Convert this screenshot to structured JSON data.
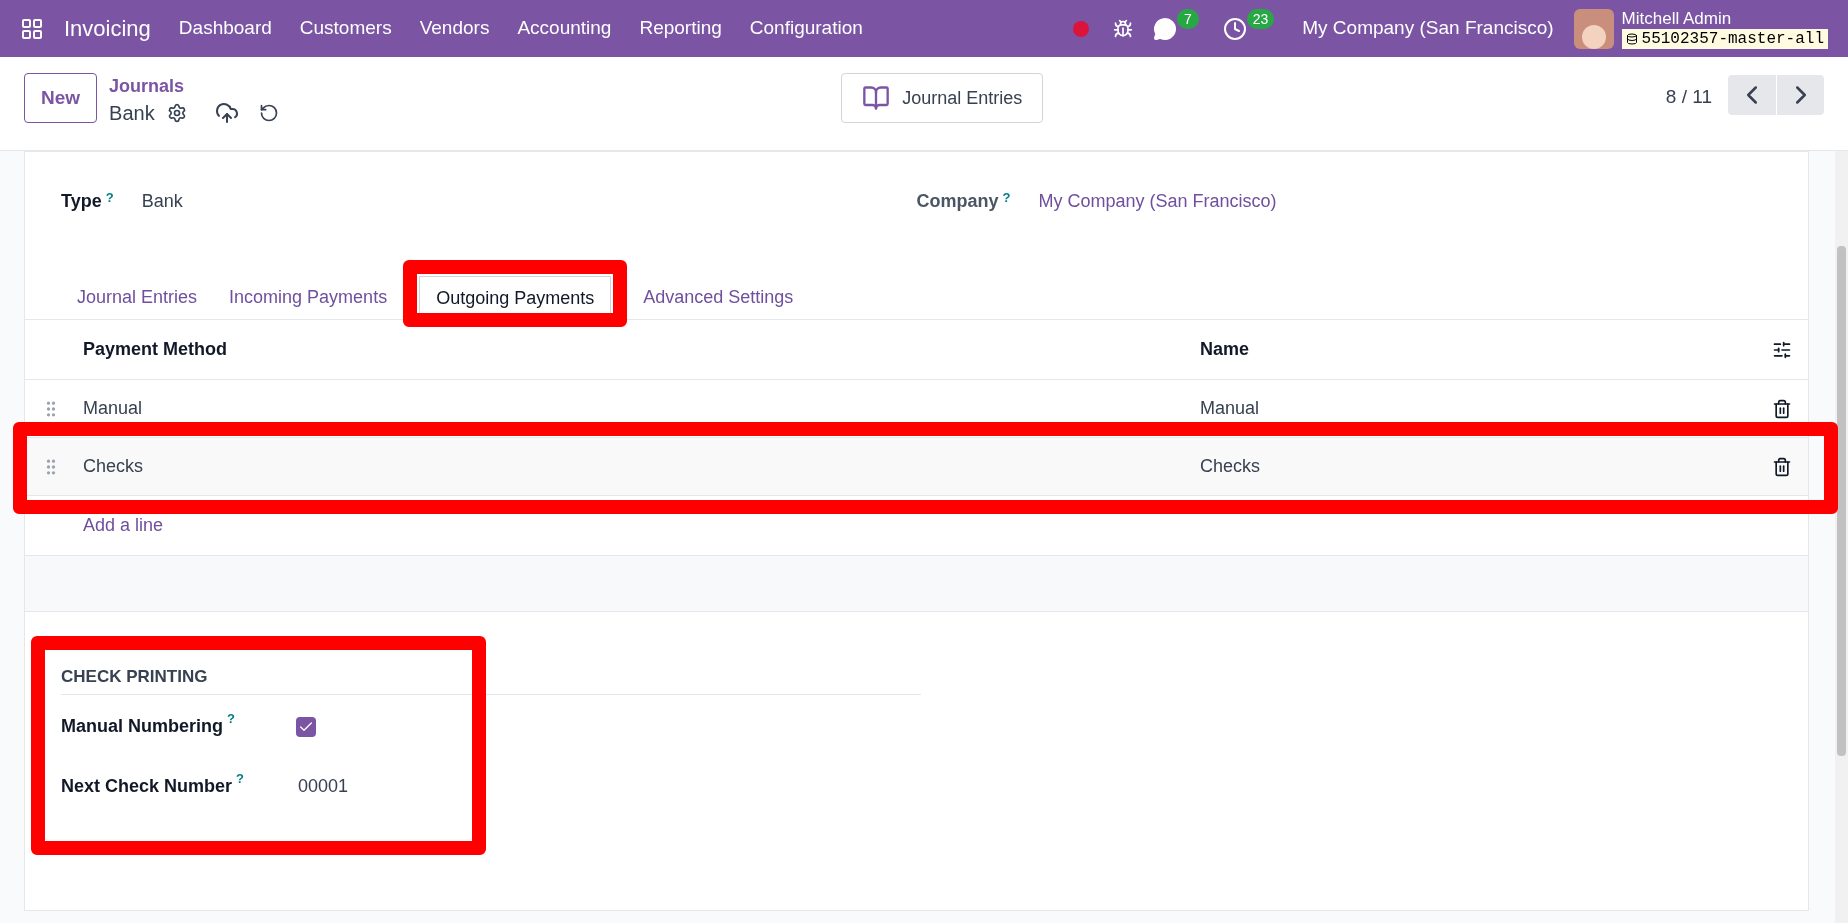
{
  "navbar": {
    "app_name": "Invoicing",
    "menu": [
      "Dashboard",
      "Customers",
      "Vendors",
      "Accounting",
      "Reporting",
      "Configuration"
    ],
    "chat_count": "7",
    "activity_count": "23",
    "company": "My Company (San Francisco)",
    "user": {
      "name": "Mitchell Admin",
      "database": "55102357-master-all"
    }
  },
  "control_panel": {
    "new_button": "New",
    "breadcrumb_parent": "Journals",
    "record": "Bank",
    "smart_button": "Journal Entries",
    "pager": "8 / 11"
  },
  "form": {
    "fields": [
      {
        "label": "Type",
        "help": "?",
        "value": "Bank",
        "kind": "text"
      },
      {
        "label": "Company",
        "help": "?",
        "value": "My Company (San Francisco)",
        "kind": "link"
      }
    ],
    "tabs": [
      {
        "label": "Journal Entries",
        "selected": false,
        "annotated": false
      },
      {
        "label": "Incoming Payments",
        "selected": false,
        "annotated": false
      },
      {
        "label": "Outgoing Payments",
        "selected": true,
        "annotated": true
      },
      {
        "label": "Advanced Settings",
        "selected": false,
        "annotated": false
      }
    ],
    "table": {
      "columns": [
        "Payment Method",
        "Name"
      ],
      "rows": [
        {
          "payment_method": "Manual",
          "name": "Manual",
          "annotated": false
        },
        {
          "payment_method": "Checks",
          "name": "Checks",
          "annotated": true
        }
      ],
      "add_line": "Add a line"
    },
    "section": {
      "title": "CHECK PRINTING",
      "annotated": true,
      "fields": [
        {
          "kind": "checkbox",
          "label": "Manual Numbering",
          "help": "?",
          "checked": true
        },
        {
          "kind": "text",
          "label": "Next Check Number",
          "help": "?",
          "value": "00001"
        }
      ]
    }
  }
}
